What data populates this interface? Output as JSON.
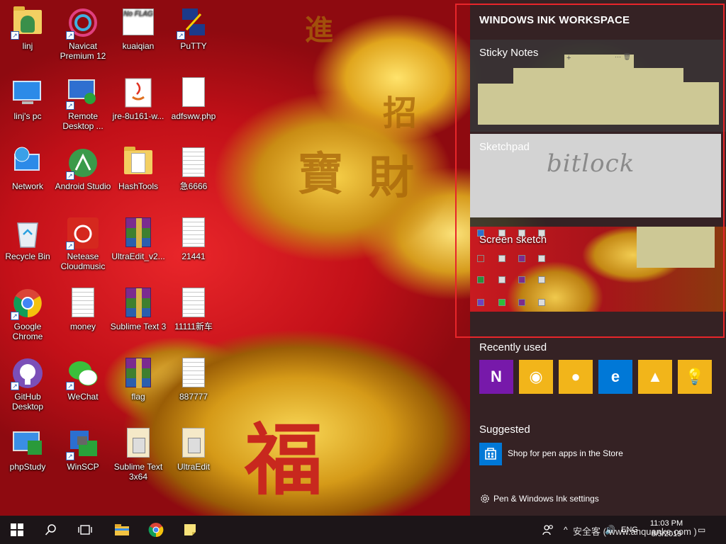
{
  "desktop": {
    "icons": [
      {
        "label": "linj",
        "kind": "user-folder"
      },
      {
        "label": "Navicat Premium 12",
        "kind": "navicat"
      },
      {
        "label": "kuaiqian",
        "kind": "image"
      },
      {
        "label": "PuTTY",
        "kind": "putty"
      },
      {
        "label": "linj's pc",
        "kind": "pc"
      },
      {
        "label": "Remote Desktop ...",
        "kind": "remote-desktop"
      },
      {
        "label": "jre-8u161-w...",
        "kind": "java"
      },
      {
        "label": "adfsww.php",
        "kind": "file"
      },
      {
        "label": "Network",
        "kind": "network"
      },
      {
        "label": "Android Studio",
        "kind": "android"
      },
      {
        "label": "HashTools",
        "kind": "folder"
      },
      {
        "label": "急6666",
        "kind": "doc"
      },
      {
        "label": "Recycle Bin",
        "kind": "recycle"
      },
      {
        "label": "Netease Cloudmusic",
        "kind": "netease"
      },
      {
        "label": "UltraEdit_v2...",
        "kind": "rar"
      },
      {
        "label": "21441",
        "kind": "doc"
      },
      {
        "label": "Google Chrome",
        "kind": "chrome"
      },
      {
        "label": "money",
        "kind": "doc"
      },
      {
        "label": "Sublime Text 3",
        "kind": "rar"
      },
      {
        "label": "11111新车",
        "kind": "doc"
      },
      {
        "label": "GitHub Desktop",
        "kind": "github"
      },
      {
        "label": "WeChat",
        "kind": "wechat"
      },
      {
        "label": "flag",
        "kind": "rar"
      },
      {
        "label": "887777",
        "kind": "doc"
      },
      {
        "label": "phpStudy",
        "kind": "phpstudy"
      },
      {
        "label": "WinSCP",
        "kind": "winscp"
      },
      {
        "label": "Sublime Text 3x64",
        "kind": "folder-doc"
      },
      {
        "label": "UltraEdit",
        "kind": "folder-doc"
      }
    ],
    "wallpaper_text": {
      "fu": "福",
      "chars": [
        "進",
        "寶",
        "財",
        "招"
      ]
    }
  },
  "ink_workspace": {
    "title": "WINDOWS INK WORKSPACE",
    "sticky_notes_label": "Sticky Notes",
    "sketchpad_label": "Sketchpad",
    "sketchpad_ink": "bitlock",
    "screen_sketch_label": "Screen sketch",
    "recently_used_label": "Recently used",
    "recent_apps": [
      {
        "icon": "onenote-icon",
        "glyph": "N",
        "color": "#7719aa"
      },
      {
        "icon": "maps-icon",
        "glyph": "◉",
        "color": "#f2b51a"
      },
      {
        "icon": "paint3d-icon",
        "glyph": "●",
        "color": "#f2b51a"
      },
      {
        "icon": "edge-icon",
        "glyph": "e",
        "color": "#0078d7"
      },
      {
        "icon": "photos-icon",
        "glyph": "▲",
        "color": "#f2b51a"
      },
      {
        "icon": "tips-icon",
        "glyph": "💡",
        "color": "#f2b51a"
      }
    ],
    "suggested_label": "Suggested",
    "suggested_item": "Shop for pen apps in the Store",
    "settings_label": "Pen & Windows Ink settings"
  },
  "taskbar": {
    "lang": "ENG",
    "time": "11:03 PM",
    "date": "8/5/2019",
    "watermark": "安全客 ( www.anquanke.com )",
    "accent": "#0078d7"
  }
}
